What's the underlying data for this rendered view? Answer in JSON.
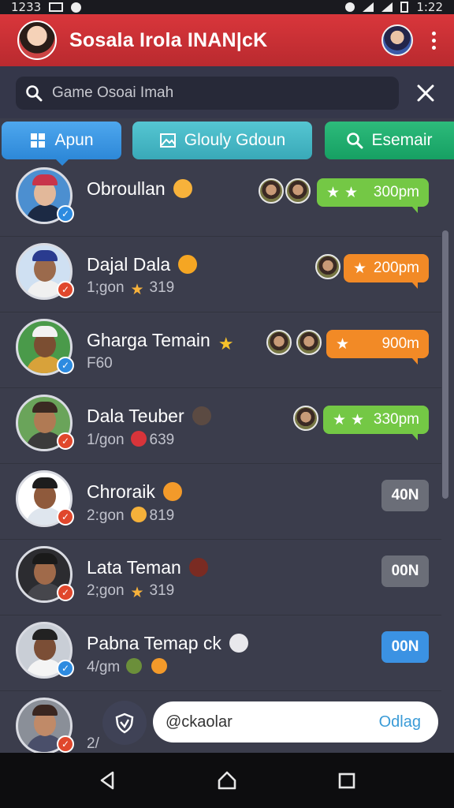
{
  "status_bar": {
    "time_left": "1233",
    "time_right": "1:22"
  },
  "app_bar": {
    "title": "Sosala Irola INAN|cK"
  },
  "search": {
    "value": "Game Osoai Imah"
  },
  "tabs": [
    {
      "label": "Apun",
      "icon": "grid-icon"
    },
    {
      "label": "Glouly Gdoun",
      "icon": "image-icon"
    },
    {
      "label": "Esemair",
      "icon": "search-icon"
    }
  ],
  "rows": [
    {
      "name": "Obroullan",
      "sub": "",
      "pill": "300pm",
      "pill_color": "#74c845",
      "badge": "blue"
    },
    {
      "name": "Dajal Dala",
      "sub_prefix": "1;gon",
      "sub_value": "319",
      "pill": "200pm",
      "pill_color": "#f28a26",
      "badge": "red"
    },
    {
      "name": "Gharga Temain",
      "sub_prefix": "",
      "sub_value": "F60",
      "pill": "900m",
      "pill_color": "#f28a26",
      "badge": "blue"
    },
    {
      "name": "Dala Teuber",
      "sub_prefix": "1/gon",
      "sub_value": "639",
      "pill": "330pm",
      "pill_color": "#74c845",
      "badge": "red"
    },
    {
      "name": "Chroraik",
      "sub_prefix": "2:gon",
      "sub_value": "819",
      "button": "40N",
      "badge": "red"
    },
    {
      "name": "Lata Teman",
      "sub_prefix": "2;gon",
      "sub_value": "319",
      "button": "00N",
      "badge": "red"
    },
    {
      "name": "Pabna Temap ck",
      "sub_prefix": "4/gm",
      "sub_value": "",
      "button": "00N",
      "badge": "blue"
    },
    {
      "name": "",
      "sub_prefix": "2/",
      "sub_value": "",
      "badge": "red"
    }
  ],
  "compose": {
    "value": "@ckaolar",
    "send_label": "Odlag"
  },
  "colors": {
    "app_bar": "#c92f34",
    "main_bg": "#3b3d4c",
    "accent_blue": "#2d88d8",
    "green": "#74c845",
    "orange": "#f28a26"
  }
}
